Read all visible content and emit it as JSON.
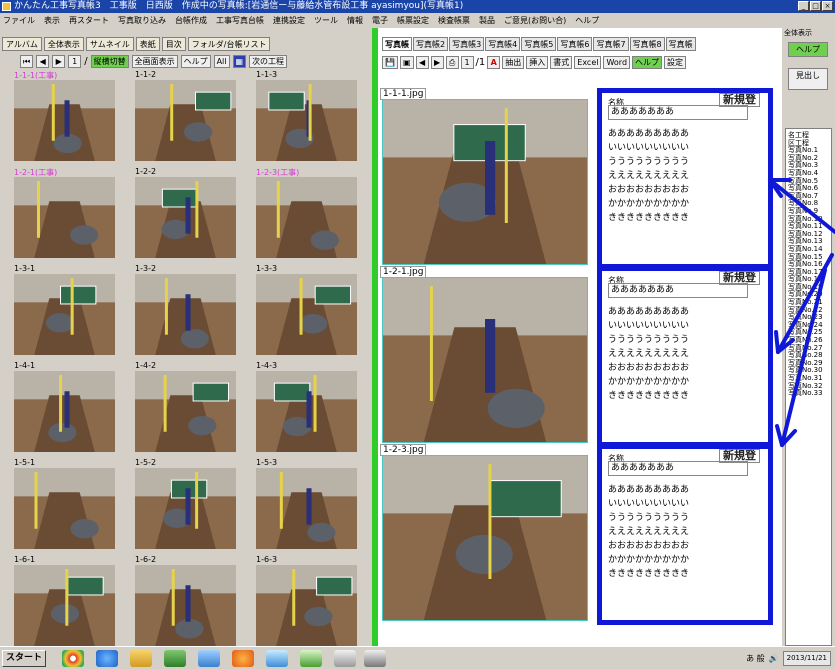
{
  "window": {
    "title": "かんたん工事写真帳3　工事版　日西版　作成中の写真帳:[岩通信ー与藤給水管布設工事 ayasimyou](写真帳1)",
    "controls": [
      "_",
      "□",
      "×"
    ]
  },
  "menu": [
    "ファイル",
    "表示",
    "再スタート",
    "写真取り込み",
    "台帳作成",
    "工事写真台帳",
    "連携設定",
    "ツール",
    "情報",
    "電子",
    "帳票設定",
    "検査帳票",
    "製品",
    "ご意見(お問い合)",
    "ヘルプ"
  ],
  "left_panel": {
    "tabs": [
      "アルバム",
      "全体表示",
      "サムネイル",
      "表紙",
      "目次",
      "フォルダ/台帳リスト"
    ],
    "toolbar": {
      "page_value": "1",
      "page_total": "/",
      "mode_label": "縦横切替",
      "view_select": "全画面表示",
      "help_label": "ヘルプ",
      "all_label": "All",
      "next_label": "次の工程"
    },
    "thumbnails": [
      {
        "label": "1-1-1(工事)",
        "highlight": true
      },
      {
        "label": "1-1-2",
        "highlight": false
      },
      {
        "label": "1-1-3",
        "highlight": false
      },
      {
        "label": "1-2-1(工事)",
        "highlight": true
      },
      {
        "label": "1-2-2",
        "highlight": false
      },
      {
        "label": "1-2-3(工事)",
        "highlight": true
      },
      {
        "label": "1-3-1",
        "highlight": false
      },
      {
        "label": "1-3-2",
        "highlight": false
      },
      {
        "label": "1-3-3",
        "highlight": false
      },
      {
        "label": "1-4-1",
        "highlight": false
      },
      {
        "label": "1-4-2",
        "highlight": false
      },
      {
        "label": "1-4-3",
        "highlight": false
      },
      {
        "label": "1-5-1",
        "highlight": false
      },
      {
        "label": "1-5-2",
        "highlight": false
      },
      {
        "label": "1-5-3",
        "highlight": false
      },
      {
        "label": "1-6-1",
        "highlight": false
      },
      {
        "label": "1-6-2",
        "highlight": false
      },
      {
        "label": "1-6-3",
        "highlight": false
      }
    ]
  },
  "right_panel": {
    "tabs": [
      "写真帳",
      "写真帳2",
      "写真帳3",
      "写真帳4",
      "写真帳5",
      "写真帳6",
      "写真帳7",
      "写真帳8",
      "写真帳"
    ],
    "toolbar": {
      "page_value": "1",
      "page_total": "/1",
      "labels": [
        "抽出",
        "挿入",
        "書式",
        "Excel",
        "Word",
        "ヘルプ",
        "設定"
      ]
    },
    "photos": [
      {
        "filename": "1-1-1.jpg",
        "header": "名称",
        "badge": "新規登",
        "title": "あああああああ",
        "lines": [
          "あああああああああ",
          "いいいいいいいいい",
          "ううううううううう",
          "えええええええええ",
          "おおおおおおおおお",
          "かかかかかかかかか",
          "ききききききききき"
        ]
      },
      {
        "filename": "1-2-1.jpg",
        "header": "名称",
        "badge": "新規登",
        "title": "あああああああ",
        "lines": [
          "あああああああああ",
          "いいいいいいいいい",
          "ううううううううう",
          "えええええええええ",
          "おおおおおおおおお",
          "かかかかかかかかか",
          "ききききききききき"
        ]
      },
      {
        "filename": "1-2-3.jpg",
        "header": "名称",
        "badge": "新規登",
        "title": "あああああああ",
        "lines": [
          "あああああああああ",
          "いいいいいいいいい",
          "ううううううううう",
          "えええええええええ",
          "おおおおおおおおお",
          "かかかかかかかかか",
          "ききききききききき"
        ]
      }
    ]
  },
  "sidebar": {
    "tab": "全体表示",
    "help": "ヘルプ",
    "list_button": "見出し",
    "items": [
      "名工程",
      "区工程",
      "写真No.1",
      "写真No.2",
      "写真No.3",
      "写真No.4",
      "写真No.5",
      "写真No.6",
      "写真No.7",
      "写真No.8",
      "写真No.9",
      "写真No.10",
      "写真No.11",
      "写真No.12",
      "写真No.13",
      "写真No.14",
      "写真No.15",
      "写真No.16",
      "写真No.17",
      "写真No.18",
      "写真No.19",
      "写真No.20",
      "写真No.21",
      "写真No.22",
      "写真No.23",
      "写真No.24",
      "写真No.25",
      "写真No.26",
      "写真No.27",
      "写真No.28",
      "写真No.29",
      "写真No.30",
      "写真No.31",
      "写真No.32",
      "写真No.33"
    ]
  },
  "taskbar": {
    "start_label": "スタート",
    "tray_text": "あ 般",
    "clock": "2013/11/21"
  },
  "colors": {
    "memo_border": "#1018d8",
    "splitter": "#2fcc2a",
    "title_bar": "#1a44a8",
    "photo_border": "#49c9c1"
  }
}
